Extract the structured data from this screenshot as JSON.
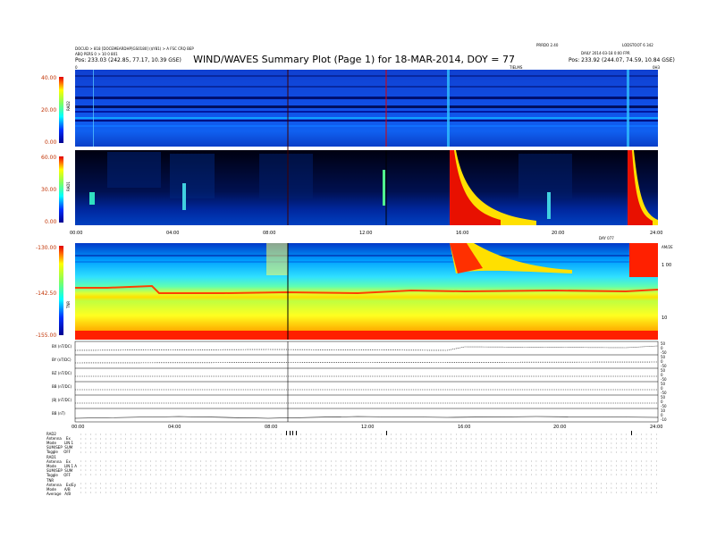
{
  "header": {
    "left_line1": "DOCUD > 818 [DOCEMEARDHP]GS0180] ($Y81) > A FSC CRQ BEP",
    "left_line2": "ABQ PERS 0 > 10 0 801",
    "left_pos": "Pos:   233.03 (242.85, 77.17, 10.39 GSE)",
    "right_line1a": "PRRDO 2.40",
    "right_line1b": "LODSTOOT 6 342",
    "right_line2": "DAILY  2014-03-18 0:00 FPR",
    "right_pos": "Pos:   233.92 (244.07, 74.59, 10.84 GSE)",
    "title": "WIND/WAVES Summary Plot (Page 1) for 18-MAR-2014, DOY = 77",
    "top_marker_left": "0",
    "top_marker_mid": "TIELMS",
    "top_marker_right": "0H3"
  },
  "chart_data": [
    {
      "type": "heatmap",
      "panel": "RAD2",
      "ylabel": "RAD2",
      "yticks": [
        "40.00",
        "20.00",
        "0.00"
      ],
      "ylim": [
        0,
        40
      ]
    },
    {
      "type": "heatmap",
      "panel": "RAD1",
      "ylabel": "RAD1",
      "yticks": [
        "60.00",
        "30.00",
        "0.00"
      ],
      "ylim": [
        0,
        60
      ]
    },
    {
      "type": "heatmap",
      "panel": "TNR",
      "ylabel": "TNR",
      "yticks": [
        "-130.00",
        "-142.50",
        "-155.00"
      ],
      "ylim": [
        -155,
        -130
      ],
      "right_label": "AM/2E",
      "right_ticks": [
        "1 00",
        "10"
      ]
    },
    {
      "type": "line",
      "panel": "housekeeping",
      "row_labels": [
        "BX (nT/DC)",
        "BY (nT/DC)",
        "BZ (nT/DC)",
        "BB (nT/DC)",
        "|B| (nT/DC)",
        "BB (nT)"
      ],
      "right_ticks": [
        "50",
        "0",
        "-50",
        "50",
        "0",
        "-50",
        "50",
        "0",
        "-50",
        "50",
        "0",
        "-50",
        "50",
        "0",
        "-50",
        "10",
        "0",
        "-10"
      ]
    }
  ],
  "time_axis": {
    "ticks_top": [
      "00:00",
      "04:00",
      "08:00",
      "12:00",
      "16:00",
      "20:00",
      "24:00"
    ],
    "ticks_bottom": [
      "00:00",
      "04:00",
      "08:00",
      "12:00",
      "16:00",
      "20:00",
      "24:00"
    ],
    "label_right": "DAY 077"
  },
  "footer": {
    "rows": [
      [
        "RAD2",
        ""
      ],
      [
        "Antenna",
        "Ex"
      ],
      [
        "Mode",
        "LIN 1"
      ],
      [
        "SUM/SEP",
        "SUM"
      ],
      [
        "Toggle",
        "OFF"
      ],
      [
        "RAD1",
        ""
      ],
      [
        "Antenna",
        "Ex"
      ],
      [
        "Mode",
        "LIN 1 A"
      ],
      [
        "SUM/SEP",
        "SUM"
      ],
      [
        "Toggle",
        "OFF"
      ],
      [
        "TNR",
        ""
      ],
      [
        "Antenna",
        "Ex/Ey"
      ],
      [
        "Mode",
        "A/B"
      ],
      [
        "Average",
        "A/B"
      ]
    ]
  },
  "colors": {
    "background": "#ffffff",
    "spectrum_low": "#0000a0",
    "spectrum_high": "#ff2000"
  }
}
